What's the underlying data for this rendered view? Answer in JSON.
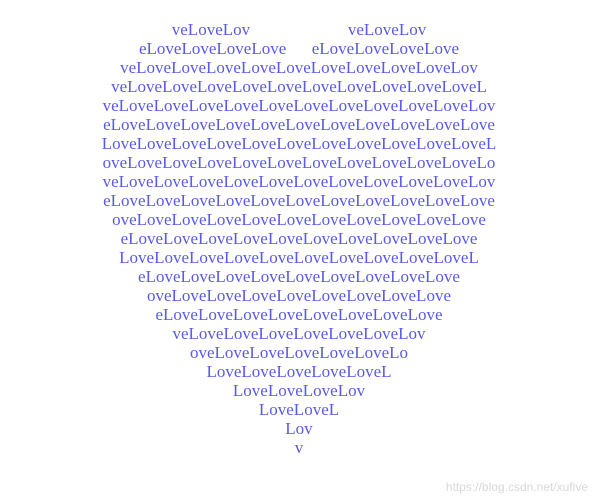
{
  "heart": {
    "lines": [
      "veLoveLov                       veLoveLov",
      "eLoveLoveLoveLove      eLoveLoveLoveLove",
      "veLoveLoveLoveLoveLoveLoveLoveLoveLoveLov",
      "veLoveLoveLoveLoveLoveLoveLoveLoveLoveLoveL",
      "veLoveLoveLoveLoveLoveLoveLoveLoveLoveLoveLov",
      "eLoveLoveLoveLoveLoveLoveLoveLoveLoveLoveLove",
      "LoveLoveLoveLoveLoveLoveLoveLoveLoveLoveLoveL",
      "oveLoveLoveLoveLoveLoveLoveLoveLoveLoveLoveLo",
      "veLoveLoveLoveLoveLoveLoveLoveLoveLoveLoveLov",
      "eLoveLoveLoveLoveLoveLoveLoveLoveLoveLoveLove",
      "oveLoveLoveLoveLoveLoveLoveLoveLoveLoveLove",
      "eLoveLoveLoveLoveLoveLoveLoveLoveLoveLove",
      "LoveLoveLoveLoveLoveLoveLoveLoveLoveLoveL",
      "eLoveLoveLoveLoveLoveLoveLoveLoveLove",
      "oveLoveLoveLoveLoveLoveLoveLoveLove",
      "eLoveLoveLoveLoveLoveLoveLoveLove",
      "veLoveLoveLoveLoveLoveLoveLov",
      "oveLoveLoveLoveLoveLoveLo",
      "LoveLoveLoveLoveLoveL",
      "LoveLoveLoveLov",
      "LoveLoveL",
      "Lov",
      "v"
    ]
  },
  "watermark": {
    "text": "https://blog.csdn.net/xufive"
  },
  "colors": {
    "text": "#5a5ae6",
    "watermark": "#d8d8d8",
    "background": "#ffffff"
  }
}
